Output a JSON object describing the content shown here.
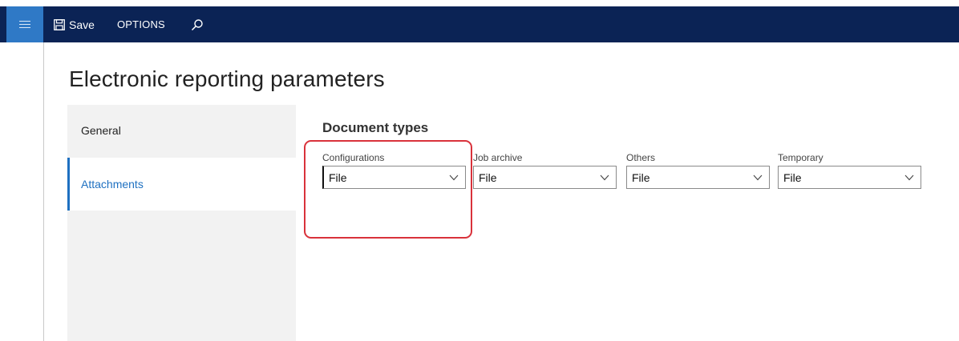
{
  "toolbar": {
    "save_label": "Save",
    "options_label": "OPTIONS",
    "icons": {
      "menu": "hamburger-icon",
      "save": "save-icon",
      "search": "search-icon"
    }
  },
  "page": {
    "title": "Electronic reporting parameters"
  },
  "nav": {
    "items": [
      {
        "label": "General",
        "selected": false
      },
      {
        "label": "Attachments",
        "selected": true
      }
    ]
  },
  "document_types": {
    "title": "Document types",
    "fields": [
      {
        "label": "Configurations",
        "value": "File"
      },
      {
        "label": "Job archive",
        "value": "File"
      },
      {
        "label": "Others",
        "value": "File"
      },
      {
        "label": "Temporary",
        "value": "File"
      }
    ]
  },
  "colors": {
    "topbar": "#0b2355",
    "menu_button": "#2f79c6",
    "accent": "#1e70c1",
    "highlight_border": "#d9323b"
  }
}
